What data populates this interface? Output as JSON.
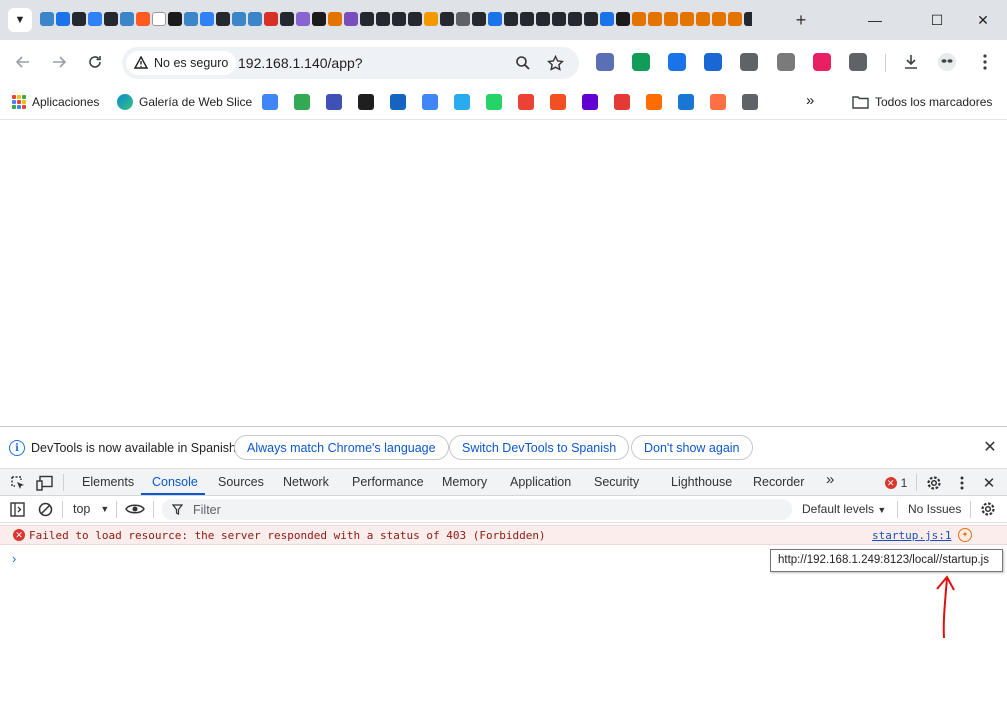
{
  "tabstrip": {
    "tab_icon_colors": [
      "#3a86c8",
      "#1a73e8",
      "#24292f",
      "#2f81f7",
      "#24292f",
      "#3a86c8",
      "#ff5a1f",
      "#ffffff",
      "#1b1b1b",
      "#3a86c8",
      "#2f81f7",
      "#24292f",
      "#3a86c8",
      "#3a86c8",
      "#d93025",
      "#24292f",
      "#8a63d2",
      "#1b1b1b",
      "#e37400",
      "#7a4dbd",
      "#24292f",
      "#24292f",
      "#24292f",
      "#24292f",
      "#f29900",
      "#24292f",
      "#5f6368",
      "#24292f",
      "#1a73e8",
      "#24292f",
      "#24292f",
      "#24292f",
      "#24292f",
      "#24292f",
      "#24292f",
      "#1a73e8",
      "#1b1b1b",
      "#e37400",
      "#e37400",
      "#e37400",
      "#e37400",
      "#e37400",
      "#e37400",
      "#e37400",
      "#24292f",
      "#24292f",
      "#24292f",
      "#5f6368"
    ],
    "new_tab_label": "+",
    "minimize_label": "—",
    "maximize_label": "☐",
    "close_label": "✕"
  },
  "toolbar": {
    "security_label": "No es seguro",
    "url": "192.168.1.140/app?",
    "extension_colors": [
      "#5b6fb5",
      "#0f9d58",
      "#1a73e8",
      "#1967d2",
      "#5f6368",
      "#7a7a7a",
      "#e91e63",
      "#5f6368"
    ]
  },
  "bookmarks": {
    "apps_label": "Aplicaciones",
    "webslice_label": "Galería de Web Slice",
    "icon_colors": [
      "#4285f4",
      "#34a853",
      "#3f51b5",
      "#1f1f1f",
      "#1565c0",
      "#4285f4",
      "#2aabee",
      "#25d366",
      "#ea4335",
      "#f25022",
      "#6001d2",
      "#e53935",
      "#ff6d00",
      "#1976d2",
      "#ff7043",
      "#5f6368"
    ],
    "more_label": "»",
    "all_bookmarks_label": "Todos los marcadores"
  },
  "devtools": {
    "infobar": {
      "message": "DevTools is now available in Spanish!",
      "btn_match": "Always match Chrome's language",
      "btn_switch": "Switch DevTools to Spanish",
      "btn_dismiss": "Don't show again"
    },
    "tabs": [
      "Elements",
      "Console",
      "Sources",
      "Network",
      "Performance",
      "Memory",
      "Application",
      "Security",
      "Lighthouse",
      "Recorder"
    ],
    "more_tabs": "»",
    "error_count": "1",
    "console": {
      "context": "top",
      "filter_placeholder": "Filter",
      "levels": "Default levels",
      "issues": "No Issues",
      "error_message": "Failed to load resource: the server responded with a status of 403 (Forbidden)",
      "error_source": "startup.js:1",
      "prompt": "›",
      "tooltip": "http://192.168.1.249:8123/local//startup.js"
    }
  }
}
